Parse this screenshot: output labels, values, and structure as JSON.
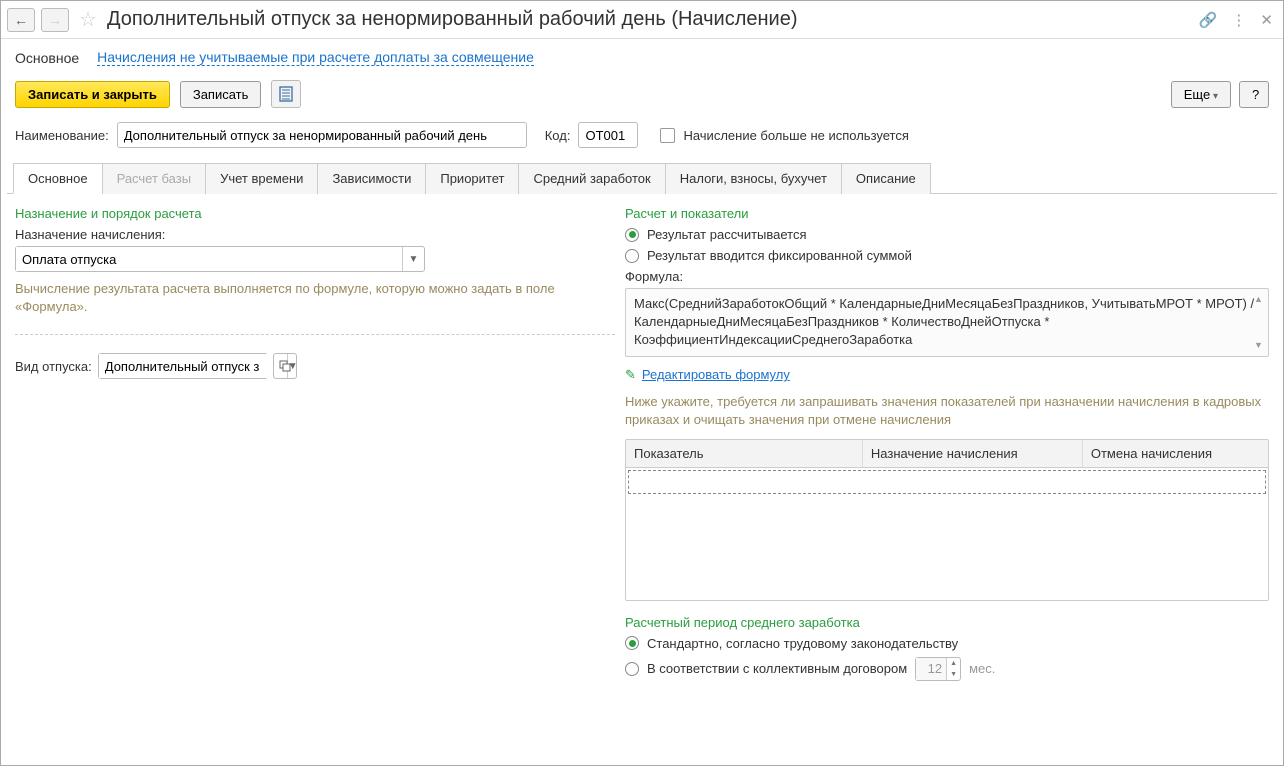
{
  "title": "Дополнительный отпуск за ненормированный рабочий день (Начисление)",
  "topTabs": {
    "main": "Основное",
    "link": "Начисления не учитываемые при расчете доплаты за совмещение"
  },
  "toolbar": {
    "saveClose": "Записать и закрыть",
    "save": "Записать",
    "more": "Еще",
    "help": "?"
  },
  "form": {
    "nameLabel": "Наименование:",
    "nameValue": "Дополнительный отпуск за ненормированный рабочий день",
    "codeLabel": "Код:",
    "codeValue": "ОТ001",
    "notUsedLabel": "Начисление больше не используется"
  },
  "tabs": {
    "t1": "Основное",
    "t2": "Расчет базы",
    "t3": "Учет времени",
    "t4": "Зависимости",
    "t5": "Приоритет",
    "t6": "Средний заработок",
    "t7": "Налоги, взносы, бухучет",
    "t8": "Описание"
  },
  "left": {
    "section1": "Назначение и порядок расчета",
    "assignLabel": "Назначение начисления:",
    "assignValue": "Оплата отпуска",
    "hint": "Вычисление результата расчета выполняется по формуле, которую можно задать в поле «Формула».",
    "vacationLabel": "Вид отпуска:",
    "vacationValue": "Дополнительный отпуск з"
  },
  "right": {
    "section1": "Расчет и показатели",
    "radio1": "Результат рассчитывается",
    "radio2": "Результат вводится фиксированной суммой",
    "formulaLabel": "Формула:",
    "formulaText": "Макс(СреднийЗаработокОбщий * КалендарныеДниМесяцаБезПраздников, УчитыватьМРОТ * МРОТ) / КалендарныеДниМесяцаБезПраздников * КоличествоДнейОтпуска * КоэффициентИндексацииСреднегоЗаработка",
    "editFormula": "Редактировать формулу",
    "hint2": "Ниже укажите, требуется ли запрашивать значения показателей при назначении начисления в кадровых приказах и очищать значения при отмене начисления",
    "th1": "Показатель",
    "th2": "Назначение начисления",
    "th3": "Отмена начисления",
    "section2": "Расчетный период среднего заработка",
    "radio3": "Стандартно, согласно трудовому законодательству",
    "radio4": "В соответствии с коллективным договором",
    "months": "12",
    "monthsLabel": "мес."
  }
}
